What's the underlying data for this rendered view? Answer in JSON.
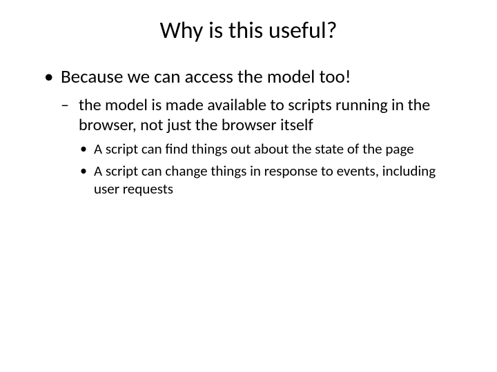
{
  "title": "Why is this useful?",
  "bullets": {
    "lvl1": [
      {
        "text": "Because we can access the model too!",
        "lvl2": [
          {
            "text": "the model is made available to scripts running in the browser, not just the browser itself",
            "lvl3": [
              {
                "text": "A script can find things out about the state of the page"
              },
              {
                "text": "A script can change things in response to events, including user requests"
              }
            ]
          }
        ]
      }
    ]
  }
}
